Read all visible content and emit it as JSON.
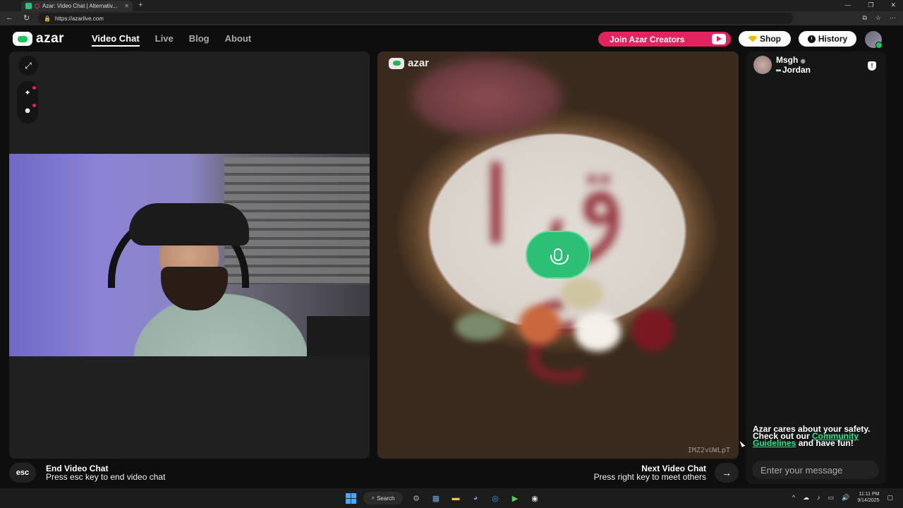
{
  "browser": {
    "tab_title": "Azar: Video Chat | Alternativ...",
    "url": "https://azarlive.com"
  },
  "header": {
    "logo_text": "azar",
    "nav": [
      "Video Chat",
      "Live",
      "Blog",
      "About"
    ],
    "join_creators_label": "Join Azar Creators",
    "shop_label": "Shop",
    "history_label": "History"
  },
  "center": {
    "logo_text": "azar",
    "watermark": "IMZ2vUWLpT"
  },
  "chat": {
    "peer_name": "Msgh",
    "peer_country": "Jordan",
    "safety_text_1": "Azar cares about your safety. Check out our",
    "safety_link": "Community Guidelines",
    "safety_text_2": "and have fun!",
    "input_placeholder": "Enter your message"
  },
  "footer": {
    "esc_key": "esc",
    "end_title": "End Video Chat",
    "end_sub": "Press esc key to end video chat",
    "next_title": "Next Video Chat",
    "next_sub": "Press right key to meet others"
  },
  "taskbar": {
    "search_label": "Search",
    "time": "11:11 PM",
    "date": "9/14/2025"
  },
  "colors": {
    "accent_green": "#2dbf74",
    "creators_pink": "#e0245e",
    "link_green": "#2ee58a"
  }
}
